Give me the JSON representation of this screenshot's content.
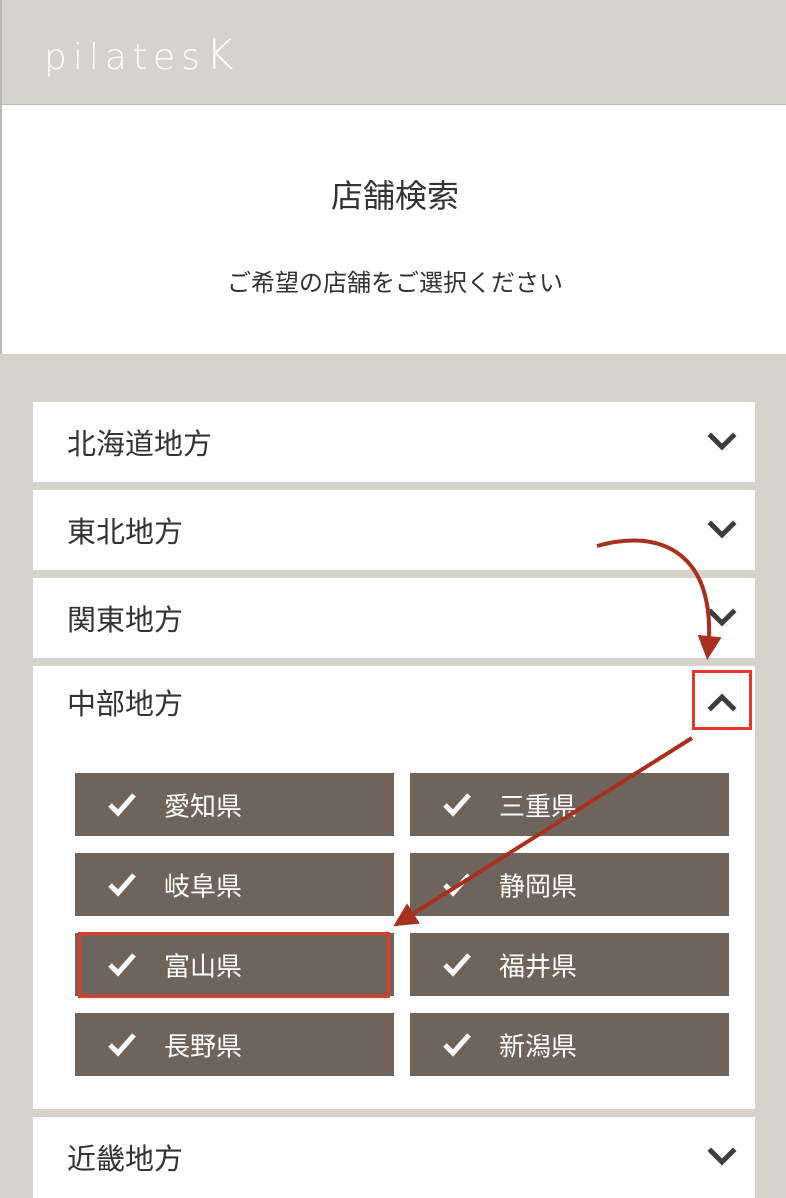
{
  "header": {
    "logo_main": "pilates",
    "logo_k": "K"
  },
  "intro": {
    "title": "店舗検索",
    "subtitle": "ご希望の店舗をご選択ください"
  },
  "regions": [
    {
      "label": "北海道地方",
      "expanded": false
    },
    {
      "label": "東北地方",
      "expanded": false
    },
    {
      "label": "関東地方",
      "expanded": false
    },
    {
      "label": "中部地方",
      "expanded": true
    },
    {
      "label": "近畿地方",
      "expanded": false
    }
  ],
  "chubu_prefectures": [
    {
      "label": "愛知県",
      "checked": true
    },
    {
      "label": "三重県",
      "checked": true
    },
    {
      "label": "岐阜県",
      "checked": true
    },
    {
      "label": "静岡県",
      "checked": true
    },
    {
      "label": "富山県",
      "checked": true
    },
    {
      "label": "福井県",
      "checked": true
    },
    {
      "label": "長野県",
      "checked": true
    },
    {
      "label": "新潟県",
      "checked": true
    }
  ],
  "colors": {
    "background": "#d6d3cc",
    "button": "#6e645c",
    "annotation": "#e03a2a",
    "arrow": "#a8301f",
    "text": "#333333"
  },
  "icons": {
    "collapsed": "chevron-down-icon",
    "expanded": "chevron-up-icon",
    "check": "check-icon"
  }
}
